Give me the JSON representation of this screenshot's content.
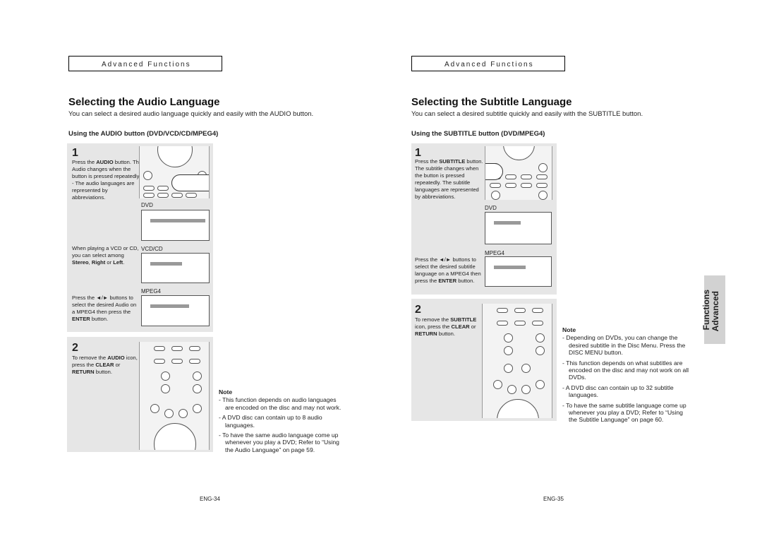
{
  "left": {
    "header": "Advanced Functions",
    "title": "Selecting the Audio Language",
    "intro": "You can select a desired audio language quickly and easily with the AUDIO button.",
    "subheading": "Using the AUDIO button (DVD/VCD/CD/MPEG4)",
    "step1": {
      "number": "1",
      "text": [
        "Press the ",
        "AUDIO",
        " button. The Audio changes when the button is pressed repeatedly."
      ],
      "bullet": "- The audio languages are represented by abbreviations.",
      "dvd_label": "DVD",
      "vcd_text": [
        "When playing a VCD or CD, you can select among ",
        "Stereo",
        ", ",
        "Right",
        " or ",
        "Left",
        "."
      ],
      "vcd_label": "VCD/CD",
      "mpeg4_label": "MPEG4",
      "mpeg4_text": [
        "Press the ◄/► buttons to select the desired Audio on a MPEG4 then press the ",
        "ENTER",
        " button."
      ]
    },
    "step2": {
      "number": "2",
      "text": [
        "To remove the ",
        "AUDIO",
        " icon, press the ",
        "CLEAR",
        " or ",
        "RETURN",
        " button."
      ]
    },
    "note": {
      "title": "Note",
      "items": [
        "- This function depends on audio languages are encoded on the disc and may not work.",
        "- A DVD disc can contain up to 8 audio languages.",
        "- To have the same audio language come up whenever you play a DVD; Refer to “Using the Audio Language” on page 59."
      ]
    },
    "page_number": "ENG-34"
  },
  "right": {
    "header": "Advanced Functions",
    "title": "Selecting the Subtitle Language",
    "intro": "You can select a desired subtitle quickly and easily with the SUBTITLE button.",
    "subheading": "Using the SUBTITLE button (DVD/MPEG4)",
    "step1": {
      "number": "1",
      "text": [
        "Press the ",
        "SUBTITLE",
        " button. The subtitle changes when the button is pressed repeatedly. The subtitle languages are represented by abbreviations."
      ],
      "dvd_label": "DVD",
      "mpeg4_label": "MPEG4",
      "mpeg4_text": [
        "Press the ◄/► buttons to select the desired subtitle language on a MPEG4 then press the ",
        "ENTER",
        " button."
      ]
    },
    "step2": {
      "number": "2",
      "text": [
        "To remove the ",
        "SUBTITLE",
        " icon, press the ",
        "CLEAR",
        " or ",
        "RETURN",
        " button."
      ]
    },
    "note": {
      "title": "Note",
      "items": [
        "- Depending on DVDs, you can change the desired subtitle in the Disc Menu. Press the DISC MENU button.",
        "- This function depends on what subtitles are encoded on the disc and may not work on all DVDs.",
        "- A DVD disc can contain up to 32 subtitle languages.",
        "- To have the same subtitle language come up whenever you play a DVD; Refer to “Using the Subtitle Language” on page 60."
      ]
    },
    "page_number": "ENG-35"
  },
  "side_tab": {
    "line1": "Advanced",
    "line2": "Functions"
  }
}
